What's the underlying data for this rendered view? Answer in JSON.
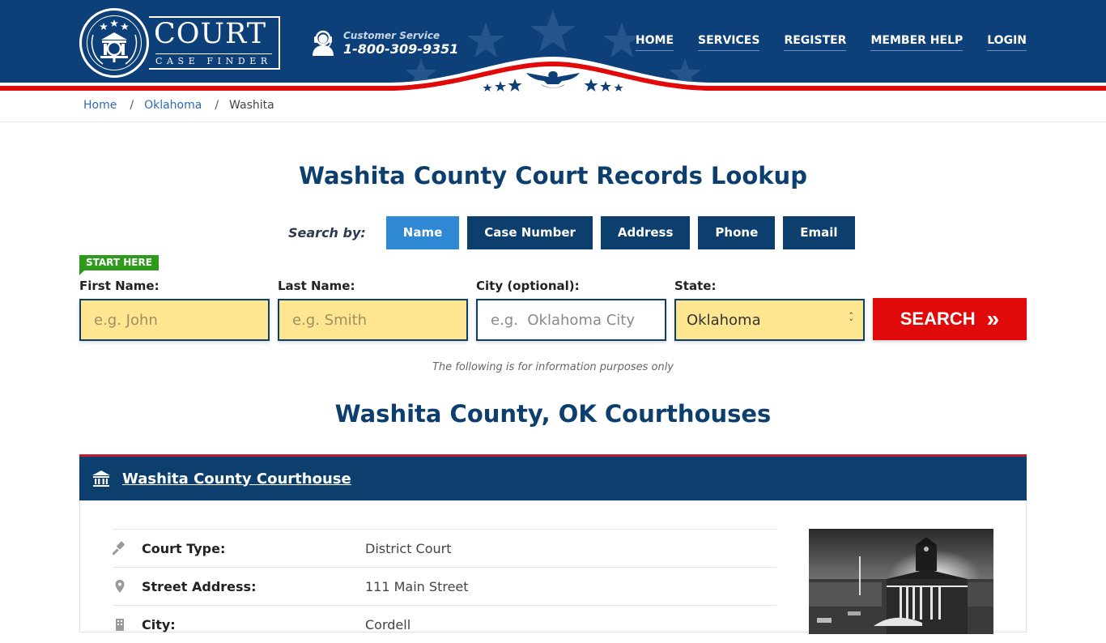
{
  "brand": {
    "name": "COURT",
    "subtitle": "CASE FINDER"
  },
  "customer_service": {
    "label": "Customer Service",
    "phone": "1-800-309-9351"
  },
  "nav": {
    "items": [
      {
        "label": "HOME"
      },
      {
        "label": "SERVICES"
      },
      {
        "label": "REGISTER"
      },
      {
        "label": "MEMBER HELP"
      },
      {
        "label": "LOGIN"
      }
    ]
  },
  "breadcrumb": {
    "items": [
      {
        "label": "Home",
        "link": true
      },
      {
        "label": "Oklahoma",
        "link": true
      },
      {
        "label": "Washita",
        "link": false
      }
    ],
    "separator": "/"
  },
  "main": {
    "title": "Washita County Court Records Lookup",
    "search_by_label": "Search by:",
    "tabs": [
      {
        "label": "Name",
        "active": true
      },
      {
        "label": "Case Number",
        "active": false
      },
      {
        "label": "Address",
        "active": false
      },
      {
        "label": "Phone",
        "active": false
      },
      {
        "label": "Email",
        "active": false
      }
    ],
    "start_here": "START HERE",
    "form": {
      "first_name": {
        "label": "First Name:",
        "placeholder": "e.g. John",
        "value": ""
      },
      "last_name": {
        "label": "Last Name:",
        "placeholder": "e.g. Smith",
        "value": ""
      },
      "city": {
        "label": "City (optional):",
        "placeholder": "e.g.  Oklahoma City",
        "value": ""
      },
      "state": {
        "label": "State:",
        "selected": "Oklahoma"
      },
      "search_button": "SEARCH",
      "search_button_icon": "»"
    },
    "info_note": "The following is for information purposes only",
    "section_title": "Washita County, OK Courthouses"
  },
  "courthouse": {
    "name": "Washita County Courthouse",
    "rows": [
      {
        "icon": "gavel-icon",
        "label": "Court Type:",
        "value": "District Court"
      },
      {
        "icon": "map-pin-icon",
        "label": "Street Address:",
        "value": "111 Main Street"
      },
      {
        "icon": "building-icon",
        "label": "City:",
        "value": "Cordell"
      }
    ]
  },
  "colors": {
    "primary_navy": "#0d3f6e",
    "accent_red": "#e00a0a",
    "tab_active": "#2e88d4",
    "input_yellow": "#fde68f",
    "start_green": "#2e9a1b"
  }
}
